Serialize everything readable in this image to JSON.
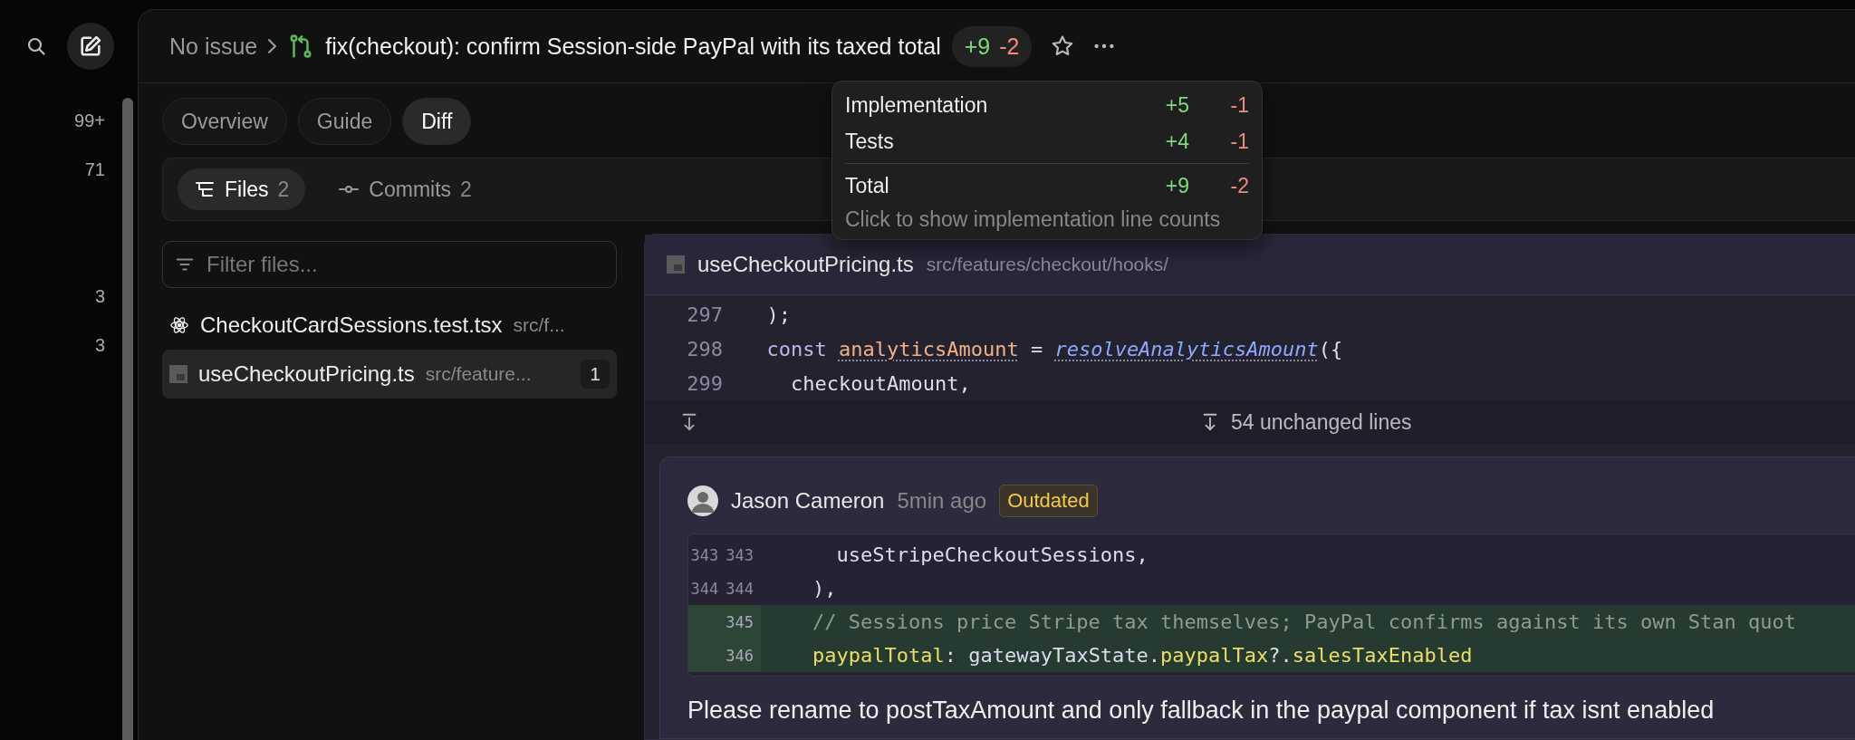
{
  "rail": {
    "counts": [
      "99+",
      "71",
      "3",
      "3"
    ]
  },
  "header": {
    "breadcrumb": "No issue",
    "title": "fix(checkout): confirm Session-side PayPal with its taxed total",
    "additions": "+9",
    "deletions": "-2"
  },
  "tabs": [
    {
      "label": "Overview",
      "selected": false
    },
    {
      "label": "Guide",
      "selected": false
    },
    {
      "label": "Diff",
      "selected": true
    }
  ],
  "subtabs": [
    {
      "kind": "files",
      "label": "Files",
      "count": "2",
      "selected": true
    },
    {
      "kind": "commits",
      "label": "Commits",
      "count": "2",
      "selected": false
    }
  ],
  "filter": {
    "placeholder": "Filter files..."
  },
  "files": [
    {
      "kind": "react",
      "name": "CheckoutCardSessions.test.tsx",
      "path": "src/f...",
      "selected": false
    },
    {
      "kind": "ts",
      "name": "useCheckoutPricing.ts",
      "path": "src/feature...",
      "comments": "1",
      "selected": true
    }
  ],
  "popover": {
    "rows": [
      {
        "label": "Implementation",
        "additions": "+5",
        "deletions": "-1"
      },
      {
        "label": "Tests",
        "additions": "+4",
        "deletions": "-1"
      }
    ],
    "total": {
      "label": "Total",
      "additions": "+9",
      "deletions": "-2"
    },
    "hint": "Click to show implementation line counts"
  },
  "diff": {
    "file": "useCheckoutPricing.ts",
    "path": "src/features/checkout/hooks/",
    "lines": [
      {
        "number": "297",
        "tokens": [
          {
            "kind": "plain",
            "text": "  );"
          }
        ]
      },
      {
        "number": "298",
        "tokens": [
          {
            "kind": "keyword",
            "text": "  const "
          },
          {
            "kind": "variable",
            "text": "analyticsAmount"
          },
          {
            "kind": "plain",
            "text": " = "
          },
          {
            "kind": "function",
            "text": "resolveAnalyticsAmount"
          },
          {
            "kind": "plain",
            "text": "({"
          }
        ]
      },
      {
        "number": "299",
        "tokens": [
          {
            "kind": "plain",
            "text": "    checkoutAmount,"
          }
        ]
      }
    ],
    "collapsed": "54 unchanged lines"
  },
  "comment": {
    "author": "Jason Cameron",
    "time": "5min ago",
    "badge": "Outdated",
    "snippet": [
      {
        "old": "343",
        "new": "343",
        "added": false,
        "tokens": [
          {
            "kind": "plain",
            "text": "      useStripeCheckoutSessions,"
          }
        ]
      },
      {
        "old": "344",
        "new": "344",
        "added": false,
        "tokens": [
          {
            "kind": "plain",
            "text": "    ),"
          }
        ]
      },
      {
        "new": "345",
        "added": true,
        "tokens": [
          {
            "kind": "comment",
            "text": "    // Sessions price Stripe tax themselves; PayPal confirms against its own Stan quot"
          }
        ]
      },
      {
        "new": "346",
        "added": true,
        "tokens": [
          {
            "kind": "property",
            "text": "    paypalTotal"
          },
          {
            "kind": "plain",
            "text": ": gatewayTaxState."
          },
          {
            "kind": "property",
            "text": "paypalTax"
          },
          {
            "kind": "plain",
            "text": "?."
          },
          {
            "kind": "property",
            "text": "salesTaxEnabled"
          }
        ]
      }
    ],
    "body": "Please rename to postTaxAmount and only fallback in the paypal component if tax isnt enabled"
  }
}
